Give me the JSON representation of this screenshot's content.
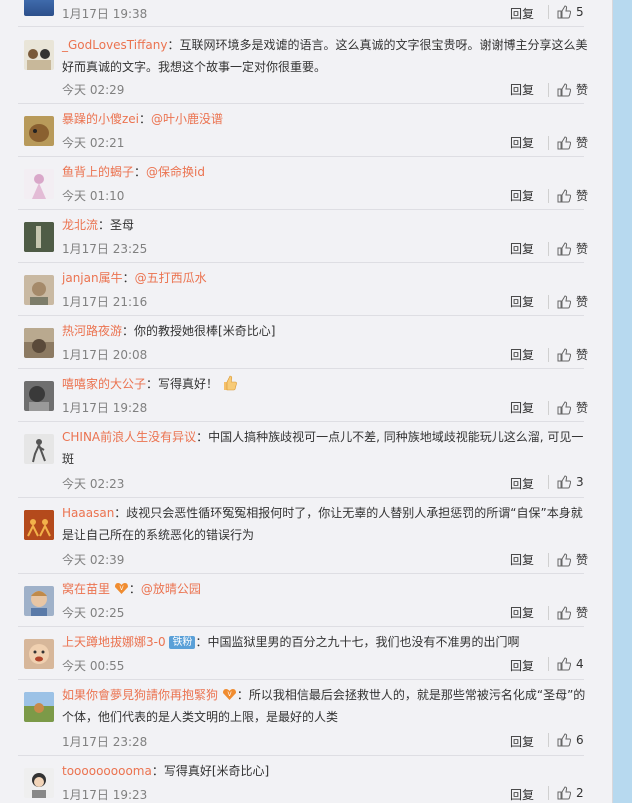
{
  "comments": [
    {
      "name": null,
      "text": "",
      "time": "1月17日 19:38",
      "reply": "回复",
      "like": "5"
    },
    {
      "name": "_GodLovesTiffany",
      "text": "：互联网环境多是戏谑的语言。这么真诚的文字很宝贵呀。谢谢博主分享这么美",
      "text2": "好而真诚的文字。我想这个故事一定对你很重要。",
      "time": "今天 02:29",
      "reply": "回复",
      "like": "赞"
    },
    {
      "name": "暴躁的小傻zei",
      "sep": "：",
      "mention": "@叶小鹿没谱",
      "time": "今天 02:21",
      "reply": "回复",
      "like": "赞"
    },
    {
      "name": "鱼背上的蝎子",
      "sep": "：",
      "mention": "@保命换id",
      "time": "今天 01:10",
      "reply": "回复",
      "like": "赞"
    },
    {
      "name": "龙北流",
      "text": "：圣母",
      "time": "1月17日 23:25",
      "reply": "回复",
      "like": "赞"
    },
    {
      "name": "janjan属牛",
      "sep": "：",
      "mention": "@五打西瓜水",
      "time": "1月17日 21:16",
      "reply": "回复",
      "like": "赞"
    },
    {
      "name": "热河路夜游",
      "text": "：你的教授她很棒[米奇比心]",
      "time": "1月17日 20:08",
      "reply": "回复",
      "like": "赞"
    },
    {
      "name": "嘻嘻家的大公子",
      "text": "：写得真好！",
      "time": "1月17日 19:28",
      "reply": "回复",
      "like": "赞"
    },
    {
      "name": "CHINA前浪人生没有异议",
      "text": "：中国人搞种族歧视可一点儿不差, 同种族地域歧视能玩儿这么溜, 可见一",
      "text2": "斑",
      "time": "今天 02:23",
      "reply": "回复",
      "like": "3"
    },
    {
      "name": "Haaasan",
      "text": "：歧视只会恶性循环冤冤相报何时了，你让无辜的人替别人承担惩罚的所谓“自保”本身就",
      "text2": "是让自己所在的系统恶化的错误行为",
      "time": "今天 02:39",
      "reply": "回复",
      "like": "赞"
    },
    {
      "name": "窝在苗里",
      "sep": "：",
      "mention": "@放晴公园",
      "time": "今天 02:25",
      "reply": "回复",
      "like": "赞"
    },
    {
      "name": "上天蹲地拔娜娜3-0",
      "badge": "铁粉",
      "text": "：中国监狱里男的百分之九十七，我们也没有不准男的出门啊",
      "time": "今天 00:55",
      "reply": "回复",
      "like": "4"
    },
    {
      "name": "如果你會夢見狗請你再抱緊狗",
      "text": "：所以我相信最后会拯救世人的，就是那些常被污名化成“圣母”的",
      "text2": "个体，他们代表的是人类文明的上限，是最好的人类",
      "time": "1月17日 23:28",
      "reply": "回复",
      "like": "6"
    },
    {
      "name": "toooooooooma",
      "text": "：写得真好[米奇比心]",
      "time": "1月17日 19:23",
      "reply": "回复",
      "like": "2"
    }
  ],
  "colors": {
    "username": "#eb7350",
    "text": "#333333",
    "time": "#808080",
    "badge": "#5aa0d8"
  }
}
